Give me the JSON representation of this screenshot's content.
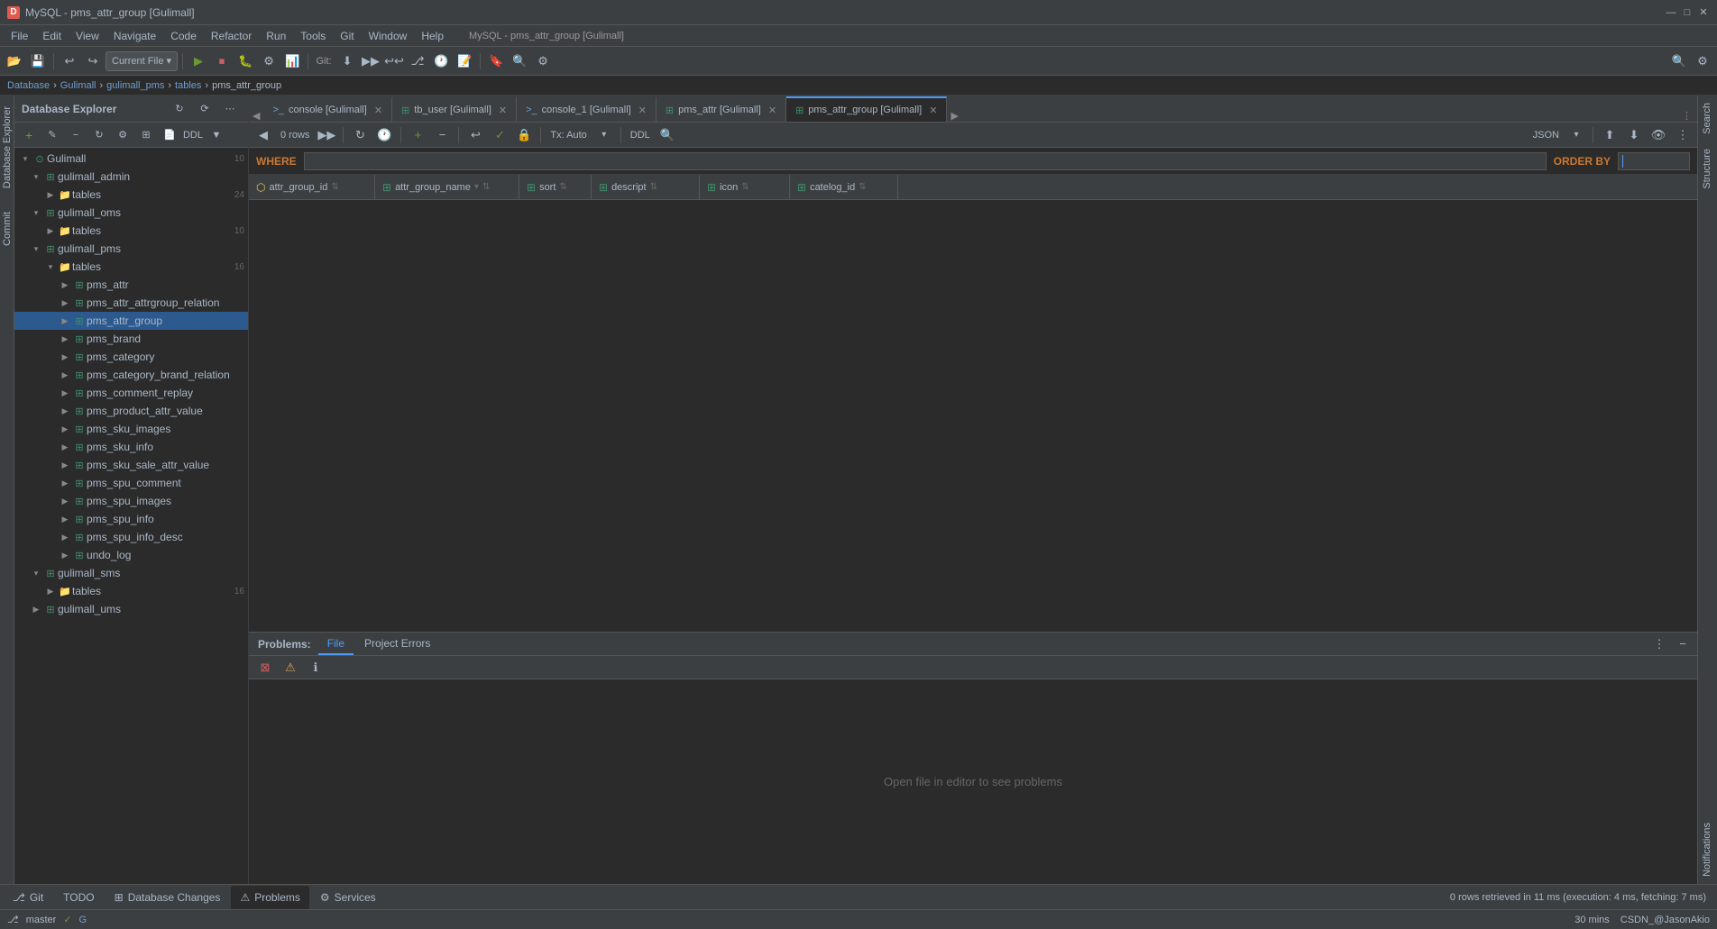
{
  "titleBar": {
    "title": "MySQL - pms_attr_group [Gulimall]",
    "logoText": "D",
    "controls": [
      "—",
      "□",
      "✕"
    ]
  },
  "menuBar": {
    "items": [
      "File",
      "Edit",
      "View",
      "Navigate",
      "Code",
      "Refactor",
      "Run",
      "Tools",
      "Git",
      "Window",
      "Help"
    ]
  },
  "toolbar": {
    "dropdown": "Current File ▾",
    "gitLabel": "Git:",
    "buttons": [
      "open",
      "save",
      "revert",
      "back",
      "forward",
      "run",
      "stop",
      "debug",
      "coverage",
      "profile",
      "git",
      "push",
      "pull",
      "rebase",
      "update",
      "commit",
      "history",
      "annotate"
    ]
  },
  "breadcrumb": {
    "items": [
      "Database",
      "Gulimall",
      "gulimall_pms",
      "tables",
      "pms_attr_group"
    ]
  },
  "sidebar": {
    "title": "Database Explorer",
    "tree": [
      {
        "id": "gulimall",
        "label": "Gulimall",
        "badge": "10",
        "level": 0,
        "type": "db",
        "expanded": true,
        "arrow": "▾"
      },
      {
        "id": "gulimall_admin",
        "label": "gulimall_admin",
        "level": 1,
        "type": "schema",
        "expanded": true,
        "arrow": "▾"
      },
      {
        "id": "tables_admin",
        "label": "tables",
        "badge": "24",
        "level": 2,
        "type": "folder",
        "expanded": false,
        "arrow": "▶"
      },
      {
        "id": "gulimall_oms",
        "label": "gulimall_oms",
        "level": 1,
        "type": "schema",
        "expanded": true,
        "arrow": "▾"
      },
      {
        "id": "tables_oms",
        "label": "tables",
        "badge": "10",
        "level": 2,
        "type": "folder",
        "expanded": false,
        "arrow": "▶"
      },
      {
        "id": "gulimall_pms",
        "label": "gulimall_pms",
        "level": 1,
        "type": "schema",
        "expanded": true,
        "arrow": "▾"
      },
      {
        "id": "tables_pms",
        "label": "tables",
        "badge": "16",
        "level": 2,
        "type": "folder",
        "expanded": true,
        "arrow": "▾"
      },
      {
        "id": "pms_attr",
        "label": "pms_attr",
        "level": 3,
        "type": "table",
        "expanded": false,
        "arrow": "▶"
      },
      {
        "id": "pms_attr_attrgroup",
        "label": "pms_attr_attrgroup_relation",
        "level": 3,
        "type": "table",
        "expanded": false,
        "arrow": "▶"
      },
      {
        "id": "pms_attr_group",
        "label": "pms_attr_group",
        "level": 3,
        "type": "table",
        "expanded": false,
        "arrow": "▶",
        "selected": true
      },
      {
        "id": "pms_brand",
        "label": "pms_brand",
        "level": 3,
        "type": "table",
        "expanded": false,
        "arrow": "▶"
      },
      {
        "id": "pms_category",
        "label": "pms_category",
        "level": 3,
        "type": "table",
        "expanded": false,
        "arrow": "▶"
      },
      {
        "id": "pms_category_brand",
        "label": "pms_category_brand_relation",
        "level": 3,
        "type": "table",
        "expanded": false,
        "arrow": "▶"
      },
      {
        "id": "pms_comment_replay",
        "label": "pms_comment_replay",
        "level": 3,
        "type": "table",
        "expanded": false,
        "arrow": "▶"
      },
      {
        "id": "pms_product_attr_value",
        "label": "pms_product_attr_value",
        "level": 3,
        "type": "table",
        "expanded": false,
        "arrow": "▶"
      },
      {
        "id": "pms_sku_images",
        "label": "pms_sku_images",
        "level": 3,
        "type": "table",
        "expanded": false,
        "arrow": "▶"
      },
      {
        "id": "pms_sku_info",
        "label": "pms_sku_info",
        "level": 3,
        "type": "table",
        "expanded": false,
        "arrow": "▶"
      },
      {
        "id": "pms_sku_sale_attr_value",
        "label": "pms_sku_sale_attr_value",
        "level": 3,
        "type": "table",
        "expanded": false,
        "arrow": "▶"
      },
      {
        "id": "pms_spu_comment",
        "label": "pms_spu_comment",
        "level": 3,
        "type": "table",
        "expanded": false,
        "arrow": "▶"
      },
      {
        "id": "pms_spu_images",
        "label": "pms_spu_images",
        "level": 3,
        "type": "table",
        "expanded": false,
        "arrow": "▶"
      },
      {
        "id": "pms_spu_info",
        "label": "pms_spu_info",
        "level": 3,
        "type": "table",
        "expanded": false,
        "arrow": "▶"
      },
      {
        "id": "pms_spu_info_desc",
        "label": "pms_spu_info_desc",
        "level": 3,
        "type": "table",
        "expanded": false,
        "arrow": "▶"
      },
      {
        "id": "undo_log",
        "label": "undo_log",
        "level": 3,
        "type": "table",
        "expanded": false,
        "arrow": "▶"
      },
      {
        "id": "gulimall_sms",
        "label": "gulimall_sms",
        "level": 1,
        "type": "schema",
        "expanded": true,
        "arrow": "▾"
      },
      {
        "id": "tables_sms",
        "label": "tables",
        "badge": "16",
        "level": 2,
        "type": "folder",
        "expanded": false,
        "arrow": "▶"
      },
      {
        "id": "gulimall_ums",
        "label": "gulimall_ums",
        "level": 1,
        "type": "schema",
        "expanded": false,
        "arrow": "▶"
      }
    ]
  },
  "tabs": [
    {
      "id": "console",
      "label": "console [Gulimall]",
      "active": false,
      "closeable": true,
      "icon": ">_"
    },
    {
      "id": "tb_user",
      "label": "tb_user [Gulimall]",
      "active": false,
      "closeable": true,
      "icon": "⊞"
    },
    {
      "id": "console_1",
      "label": "console_1 [Gulimall]",
      "active": false,
      "closeable": true,
      "icon": ">_"
    },
    {
      "id": "pms_attr",
      "label": "pms_attr [Gulimall]",
      "active": false,
      "closeable": true,
      "icon": "⊞"
    },
    {
      "id": "pms_attr_group",
      "label": "pms_attr_group [Gulimall]",
      "active": true,
      "closeable": true,
      "icon": "⊞"
    }
  ],
  "queryToolbar": {
    "rowsLabel": "0 rows",
    "txLabel": "Tx: Auto",
    "ddlLabel": "DDL",
    "jsonLabel": "JSON"
  },
  "gridHeader": {
    "whereLabel": "WHERE",
    "orderByLabel": "ORDER BY",
    "columns": [
      {
        "name": "attr_group_id",
        "icon": "🔑",
        "sortable": true
      },
      {
        "name": "attr_group_name",
        "icon": "⊞",
        "sortable": true,
        "hasDropdown": true
      },
      {
        "name": "sort",
        "icon": "⊞",
        "sortable": true
      },
      {
        "name": "descript",
        "icon": "⊞",
        "sortable": true
      },
      {
        "name": "icon",
        "icon": "⊞",
        "sortable": true
      },
      {
        "name": "catelog_id",
        "icon": "⊞",
        "sortable": true
      }
    ]
  },
  "bottomPanel": {
    "tabs": [
      {
        "id": "problems",
        "label": "Problems:",
        "active": true
      },
      {
        "id": "file",
        "label": "File",
        "active": true
      },
      {
        "id": "project_errors",
        "label": "Project Errors",
        "active": false
      }
    ],
    "emptyMessage": "Open file in editor to see problems"
  },
  "bottomBar": {
    "items": [
      {
        "id": "git",
        "label": "Git",
        "icon": "⎇"
      },
      {
        "id": "todo",
        "label": "TODO",
        "icon": ""
      },
      {
        "id": "db_changes",
        "label": "Database Changes",
        "icon": ""
      },
      {
        "id": "problems",
        "label": "Problems",
        "icon": "⚠",
        "active": true
      },
      {
        "id": "services",
        "label": "Services",
        "icon": ""
      }
    ]
  },
  "statusBar": {
    "message": "0 rows retrieved in 11 ms (execution: 4 ms, fetching: 7 ms)",
    "gitBranch": "master",
    "time": "30 mins",
    "rightItems": [
      "CSDN_@JasonAkio"
    ]
  },
  "farRightTabs": [
    "Search",
    "Structure",
    "Notifications"
  ],
  "colors": {
    "accent": "#4d9bf5",
    "background": "#2b2b2b",
    "panel": "#3c3f41",
    "border": "#555555",
    "text": "#a9b7c6",
    "keyword": "#cc7832",
    "dbIcon": "#3f8f6e",
    "folderIcon": "#b5b52e"
  }
}
